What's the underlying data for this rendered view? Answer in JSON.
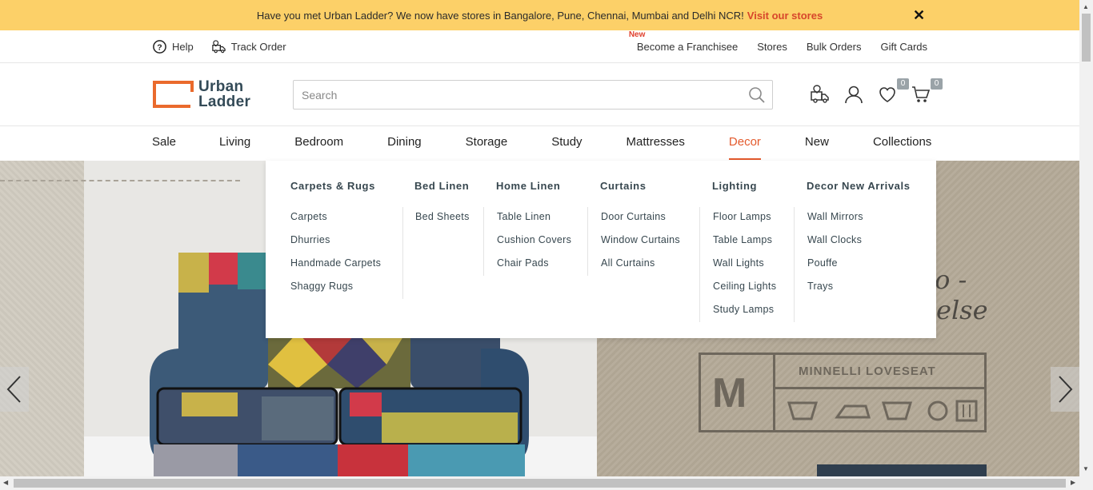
{
  "announcement": {
    "text": "Have you met Urban Ladder? We now have stores in Bangalore, Pune, Chennai, Mumbai and Delhi NCR!",
    "link": "Visit our stores",
    "close": "✕"
  },
  "utility": {
    "help": "Help",
    "track_order": "Track Order",
    "new_tag": "New",
    "franchise": "Become a Franchisee",
    "stores": "Stores",
    "bulk_orders": "Bulk Orders",
    "gift_cards": "Gift Cards"
  },
  "logo": {
    "line1": "Urban",
    "line2": "Ladder"
  },
  "search": {
    "placeholder": "Search"
  },
  "header_icons": {
    "wishlist_count": "0",
    "cart_count": "0"
  },
  "nav": [
    {
      "label": "Sale"
    },
    {
      "label": "Living"
    },
    {
      "label": "Bedroom"
    },
    {
      "label": "Dining"
    },
    {
      "label": "Storage"
    },
    {
      "label": "Study"
    },
    {
      "label": "Mattresses"
    },
    {
      "label": "Decor"
    },
    {
      "label": "New"
    },
    {
      "label": "Collections"
    }
  ],
  "mega_menu": {
    "columns": [
      {
        "heading": "Carpets & Rugs",
        "items": [
          "Carpets",
          "Dhurries",
          "Handmade Carpets",
          "Shaggy Rugs"
        ]
      },
      {
        "heading": "Bed Linen",
        "items": [
          "Bed Sheets"
        ]
      },
      {
        "heading": "Home Linen",
        "items": [
          "Table Linen",
          "Cushion Covers",
          "Chair Pads"
        ]
      },
      {
        "heading": "Curtains",
        "items": [
          "Door Curtains",
          "Window Curtains",
          "All Curtains"
        ]
      },
      {
        "heading": "Lighting",
        "items": [
          "Floor Lamps",
          "Table Lamps",
          "Wall Lights",
          "Ceiling Lights",
          "Study Lamps"
        ]
      },
      {
        "heading": "Decor New Arrivals",
        "items": [
          "Wall Mirrors",
          "Wall Clocks",
          "Pouffe",
          "Trays"
        ]
      }
    ]
  },
  "hero": {
    "script_line1": "vo -",
    "script_line2": "else",
    "label_letter": "M",
    "label_name": "MINNELLI LOVESEAT"
  },
  "colors": {
    "accent": "#e35a2d",
    "banner": "#fcd068",
    "text_dark": "#37474f"
  }
}
